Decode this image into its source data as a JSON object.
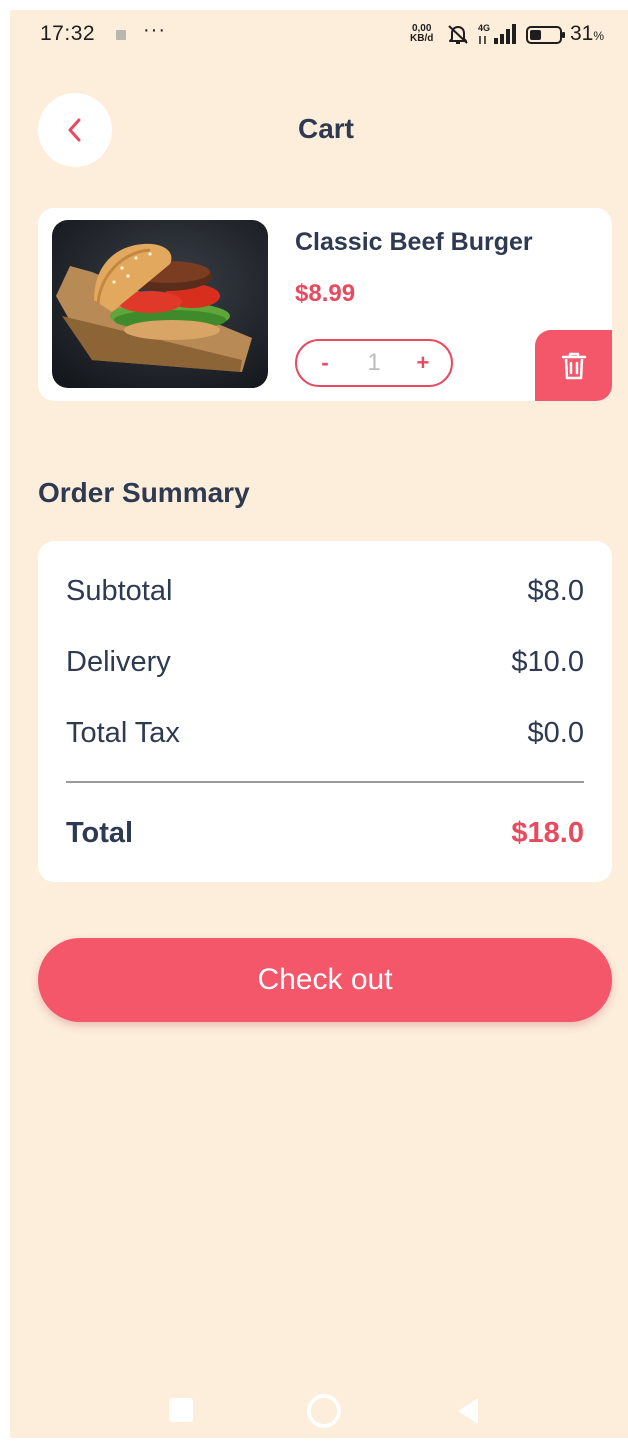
{
  "status_bar": {
    "time": "17:32",
    "dots": "···",
    "speed_value": "0,00",
    "speed_unit": "KB/d",
    "network": "4G",
    "battery_level": "31",
    "battery_unit": "%"
  },
  "header": {
    "title": "Cart",
    "back_icon": "chevron-left-icon"
  },
  "cart": {
    "items": [
      {
        "name": "Classic Beef Burger",
        "price": "$8.99",
        "quantity": "1",
        "decrement_label": "-",
        "increment_label": "+",
        "image": "burger-photo",
        "delete_icon": "trash-icon"
      }
    ]
  },
  "summary": {
    "title": "Order Summary",
    "subtotal_label": "Subtotal",
    "subtotal_value": "$8.0",
    "delivery_label": "Delivery",
    "delivery_value": "$10.0",
    "tax_label": "Total Tax",
    "tax_value": "$0.0",
    "total_label": "Total",
    "total_value": "$18.0"
  },
  "checkout": {
    "label": "Check out"
  },
  "colors": {
    "background": "#fdeddb",
    "accent": "#f4576a",
    "price": "#e84a5f",
    "text": "#2e3a51",
    "card": "#ffffff"
  }
}
